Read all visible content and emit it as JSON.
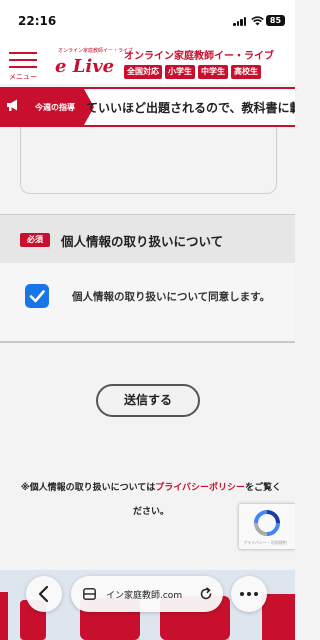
{
  "status_bar": {
    "time": "22:16",
    "battery": "85"
  },
  "header": {
    "menu_label": "メニュー",
    "logo_small": "オンライン家庭教師イー・ライブ",
    "logo_main": "e Live",
    "brand_title": "オンライン家庭教師イー・ライブ",
    "tags": [
      "全国対応",
      "小学生",
      "中学生",
      "高校生"
    ]
  },
  "ticker": {
    "label": "今週の指導",
    "text": "ていいほど出題されるので、教科書に載"
  },
  "privacy": {
    "required_badge": "必須",
    "title": "個人情報の取り扱いについて",
    "consent_text": "個人情報の取り扱いについて同意します。",
    "checked": true
  },
  "submit_label": "送信する",
  "note": {
    "prefix": "※個人情報の取り扱いについては",
    "link": "プライバシーポリシー",
    "suffix": "をご覧ください。"
  },
  "recaptcha": {
    "fine_print": "プライバシー・利用規約"
  },
  "browser": {
    "url": "イン家庭教師.com"
  },
  "colors": {
    "brand": "#c8102e",
    "checkbox": "#1976e8"
  }
}
